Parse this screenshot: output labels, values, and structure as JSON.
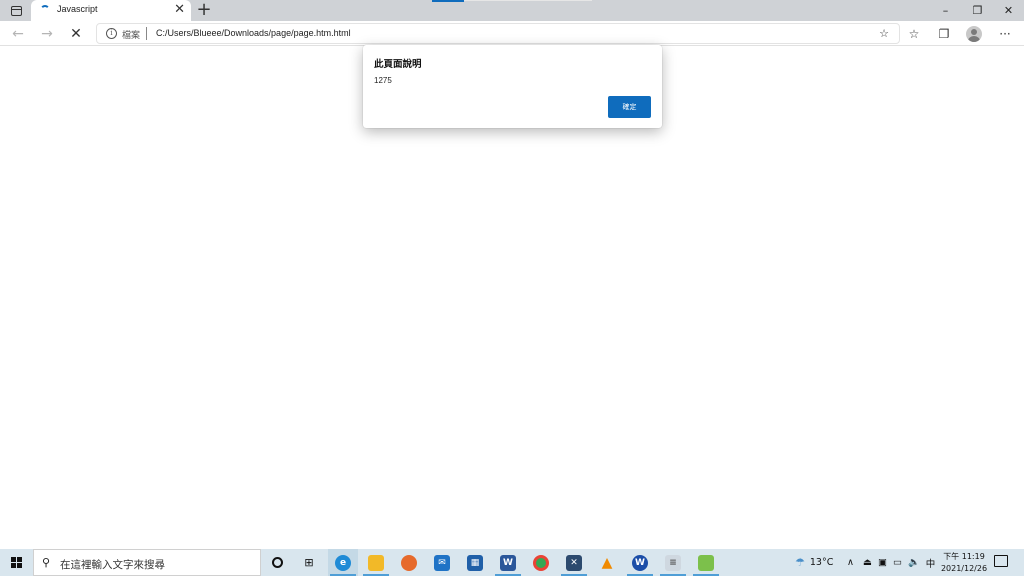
{
  "browser": {
    "tab_title": "Javascript",
    "tab_close": "✕",
    "new_tab": "+",
    "address": {
      "scheme_label": "檔案",
      "separator": "|",
      "url": "C:/Users/Blueee/Downloads/page/page.htm.html"
    },
    "window_controls": {
      "minimize": "–",
      "restore": "❐",
      "close": "✕"
    }
  },
  "dialog": {
    "title": "此頁面說明",
    "message": "1275",
    "ok_label": "確定"
  },
  "taskbar": {
    "search_placeholder": "在這裡輸入文字來搜尋",
    "weather": "13°C",
    "ime": "中",
    "time": "下午 11:19",
    "date": "2021/12/26"
  },
  "colors": {
    "accent": "#0f6cbd",
    "tabstrip": "#cfd2d6",
    "taskbar": "#d9e6ee"
  }
}
